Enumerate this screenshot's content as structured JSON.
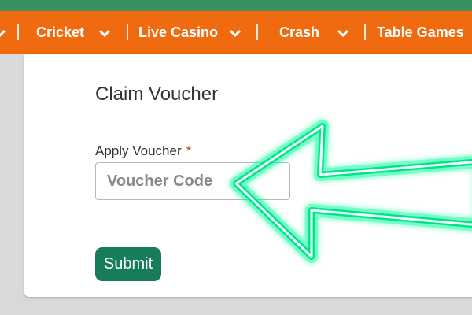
{
  "nav": {
    "items": [
      {
        "label": "Cricket"
      },
      {
        "label": "Live Casino"
      },
      {
        "label": "Crash"
      },
      {
        "label": "Table Games"
      }
    ]
  },
  "main": {
    "title": "Claim Voucher",
    "field_label": "Apply Voucher",
    "required_mark": "*",
    "voucher_placeholder": "Voucher Code",
    "voucher_value": "",
    "submit_label": "Submit"
  },
  "colors": {
    "topbar": "#3a8f63",
    "nav_background": "#f06a0f",
    "submit_background": "#167c5c",
    "required": "#d9342b",
    "arrow_glow": "#00ff9a"
  }
}
